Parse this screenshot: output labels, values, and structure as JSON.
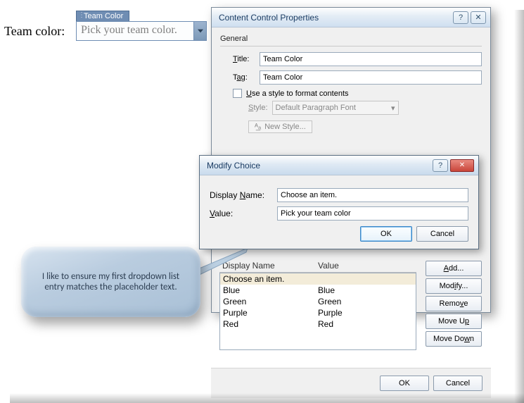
{
  "doc": {
    "field_label": "Team color:",
    "cc_tab": "Team Color",
    "cc_placeholder": "Pick your team color."
  },
  "dlg": {
    "title": "Content Control Properties",
    "general": "General",
    "title_label": "Title:",
    "title_value": "Team Color",
    "tag_label": "Tag:",
    "tag_value": "Team Color",
    "use_style": "Use a style to format contents",
    "style_label": "Style:",
    "style_value": "Default Paragraph Font",
    "new_style": "New Style...",
    "list_header_name": "Display Name",
    "list_header_value": "Value",
    "list": [
      {
        "name": "Choose an item.",
        "value": ""
      },
      {
        "name": "Blue",
        "value": "Blue"
      },
      {
        "name": "Green",
        "value": "Green"
      },
      {
        "name": "Purple",
        "value": "Purple"
      },
      {
        "name": "Red",
        "value": "Red"
      }
    ],
    "btn_add": "Add...",
    "btn_modify": "Modify...",
    "btn_remove": "Remove",
    "btn_moveup": "Move Up",
    "btn_movedown": "Move Down",
    "btn_ok": "OK",
    "btn_cancel": "Cancel"
  },
  "dlg2": {
    "title": "Modify Choice",
    "name_label": "Display Name:",
    "name_value": "Choose an item.",
    "value_label": "Value:",
    "value_value": "Pick your team color",
    "btn_ok": "OK",
    "btn_cancel": "Cancel"
  },
  "callout": {
    "text": "I like to ensure my first dropdown list entry matches the placeholder text."
  }
}
